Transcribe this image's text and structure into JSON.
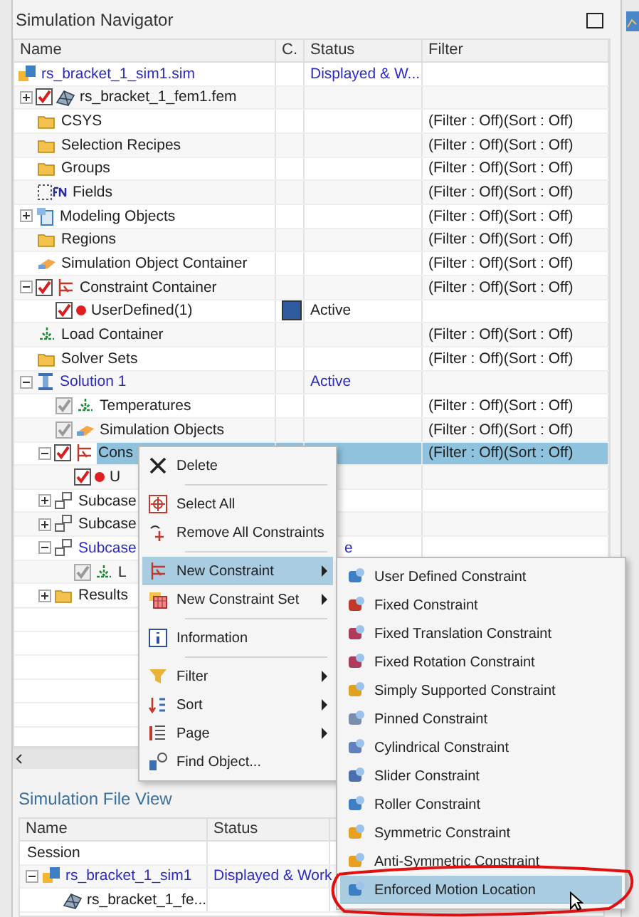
{
  "navigator": {
    "title": "Simulation Navigator",
    "columns": [
      "Name",
      "C.",
      "Status",
      "Filter"
    ],
    "tree": [
      {
        "name": "rs_bracket_1_sim1.sim",
        "kind": "sim",
        "current": true,
        "selected": false,
        "status": "Displayed & W...",
        "children": [
          {
            "name": "rs_bracket_1_fem1.fem",
            "kind": "mesh",
            "expanded": false,
            "checked": true,
            "disabled": false,
            "current": false,
            "selected": false
          },
          {
            "name": "CSYS",
            "kind": "folder",
            "current": false,
            "selected": false,
            "filter": "(Filter : Off)(Sort : Off)"
          },
          {
            "name": "Selection Recipes",
            "kind": "folder",
            "current": false,
            "selected": false,
            "filter": "(Filter : Off)(Sort : Off)"
          },
          {
            "name": "Groups",
            "kind": "folder",
            "current": false,
            "selected": false,
            "filter": "(Filter : Off)(Sort : Off)"
          },
          {
            "name": "Fields",
            "kind": "fields",
            "current": false,
            "selected": false,
            "filter": "(Filter : Off)(Sort : Off)"
          },
          {
            "name": "Modeling Objects",
            "kind": "objects",
            "expanded": false,
            "current": false,
            "selected": false,
            "filter": "(Filter : Off)(Sort : Off)"
          },
          {
            "name": "Regions",
            "kind": "folder",
            "current": false,
            "selected": false,
            "filter": "(Filter : Off)(Sort : Off)"
          },
          {
            "name": "Simulation Object Container",
            "kind": "container",
            "current": false,
            "selected": false,
            "filter": "(Filter : Off)(Sort : Off)"
          },
          {
            "name": "Constraint Container",
            "kind": "constraint",
            "expanded": true,
            "checked": true,
            "disabled": false,
            "current": false,
            "selected": false,
            "filter": "(Filter : Off)(Sort : Off)",
            "children": [
              {
                "name": "UserDefined(1)",
                "kind": "dot",
                "checked": true,
                "disabled": false,
                "current": false,
                "selected": false,
                "color": "#2e5c9e",
                "status": "Active"
              }
            ]
          },
          {
            "name": "Load Container",
            "kind": "load",
            "current": false,
            "selected": false,
            "filter": "(Filter : Off)(Sort : Off)"
          },
          {
            "name": "Solver Sets",
            "kind": "folder",
            "current": false,
            "selected": false,
            "filter": "(Filter : Off)(Sort : Off)"
          },
          {
            "name": "Solution 1",
            "kind": "solution",
            "expanded": true,
            "current": true,
            "selected": false,
            "status": "Active",
            "children": [
              {
                "name": "Temperatures",
                "kind": "load",
                "checked": true,
                "disabled": true,
                "current": false,
                "selected": false,
                "filter": "(Filter : Off)(Sort : Off)"
              },
              {
                "name": "Simulation Objects",
                "kind": "container",
                "checked": true,
                "disabled": true,
                "current": false,
                "selected": false,
                "filter": "(Filter : Off)(Sort : Off)"
              },
              {
                "name": "Cons",
                "kind": "constraint",
                "expanded": true,
                "checked": true,
                "disabled": false,
                "current": false,
                "selected": true,
                "filter": "(Filter : Off)(Sort : Off)",
                "children": [
                  {
                    "name": "U",
                    "kind": "dot",
                    "checked": true,
                    "disabled": false,
                    "current": false,
                    "selected": false
                  }
                ]
              },
              {
                "name": "Subcase",
                "kind": "subcase",
                "expanded": false,
                "current": false,
                "selected": false
              },
              {
                "name": "Subcase",
                "kind": "subcase",
                "expanded": false,
                "current": false,
                "selected": false
              },
              {
                "name": "Subcase",
                "kind": "subcase",
                "expanded": true,
                "current": true,
                "selected": false,
                "status": "e",
                "children": [
                  {
                    "name": "L",
                    "kind": "load",
                    "checked": true,
                    "disabled": true,
                    "current": false,
                    "selected": false
                  }
                ]
              },
              {
                "name": "Results",
                "kind": "folder",
                "expanded": false,
                "current": false,
                "selected": false
              }
            ]
          }
        ]
      }
    ]
  },
  "context_menu": {
    "items": [
      {
        "kind": "item",
        "label": "Delete",
        "submenu": false,
        "selected": false
      },
      {
        "kind": "separator"
      },
      {
        "kind": "item",
        "label": "Select All",
        "submenu": false,
        "selected": false
      },
      {
        "kind": "item",
        "label": "Remove All Constraints",
        "submenu": false,
        "selected": false
      },
      {
        "kind": "separator"
      },
      {
        "kind": "item",
        "label": "New Constraint",
        "submenu": true,
        "selected": true
      },
      {
        "kind": "item",
        "label": "New Constraint Set",
        "submenu": true,
        "selected": false
      },
      {
        "kind": "separator"
      },
      {
        "kind": "item",
        "label": "Information",
        "submenu": false,
        "selected": false
      },
      {
        "kind": "separator"
      },
      {
        "kind": "item",
        "label": "Filter",
        "submenu": true,
        "selected": false
      },
      {
        "kind": "item",
        "label": "Sort",
        "submenu": true,
        "selected": false
      },
      {
        "kind": "item",
        "label": "Page",
        "submenu": true,
        "selected": false
      },
      {
        "kind": "item",
        "label": "Find Object...",
        "submenu": false,
        "selected": false
      }
    ]
  },
  "submenu": {
    "items": [
      {
        "label": "User Defined Constraint",
        "selected": false
      },
      {
        "label": "Fixed Constraint",
        "selected": false
      },
      {
        "label": "Fixed Translation Constraint",
        "selected": false
      },
      {
        "label": "Fixed Rotation Constraint",
        "selected": false
      },
      {
        "label": "Simply Supported Constraint",
        "selected": false
      },
      {
        "label": "Pinned Constraint",
        "selected": false
      },
      {
        "label": "Cylindrical Constraint",
        "selected": false
      },
      {
        "label": "Slider Constraint",
        "selected": false
      },
      {
        "label": "Roller Constraint",
        "selected": false
      },
      {
        "label": "Symmetric Constraint",
        "selected": false
      },
      {
        "label": "Anti-Symmetric Constraint",
        "selected": false
      },
      {
        "label": "Enforced Motion Location",
        "selected": true
      }
    ]
  },
  "file_view": {
    "title": "Simulation File View",
    "columns": [
      "Name",
      "Status"
    ],
    "rows": [
      {
        "name": "Session",
        "current": false
      },
      {
        "name": "rs_bracket_1_sim1",
        "kind": "sim",
        "expanded": true,
        "current": true,
        "status": "Displayed & Work",
        "children": [
          {
            "name": "rs_bracket_1_fe...",
            "kind": "mesh",
            "current": false
          }
        ]
      }
    ]
  }
}
